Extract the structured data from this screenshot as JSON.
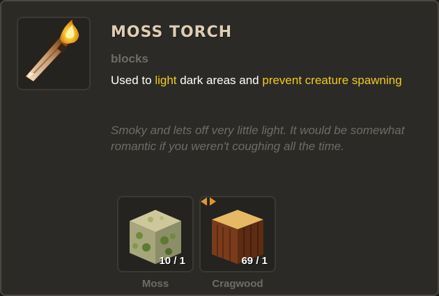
{
  "item": {
    "title": "Moss Torch",
    "category": "blocks",
    "icon": "moss-torch-icon",
    "description": {
      "part1": "Used to ",
      "highlight1": "light",
      "part2": " dark areas and ",
      "highlight2": "prevent creature spawning"
    },
    "flavor": "Smoky and lets off very little light. It would be somewhat romantic if you weren't coughing all the time."
  },
  "recipe": {
    "ingredients": [
      {
        "name": "Moss",
        "count": "10 / 1",
        "icon": "moss-block-icon"
      },
      {
        "name": "Cragwood",
        "count": "69 / 1",
        "icon": "cragwood-block-icon",
        "has_swap": true
      }
    ]
  },
  "colors": {
    "highlight": "#f2cb1f",
    "panel": "#2b2a26",
    "muted_text": "#6e6c66"
  }
}
